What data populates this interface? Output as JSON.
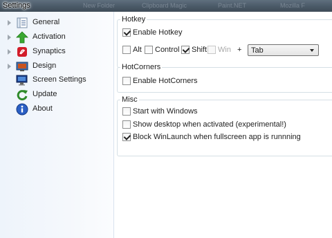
{
  "window": {
    "title": "Settings",
    "background_tabs": [
      "New Folder",
      "Clipboard Magic",
      "Paint.NET",
      "Mozilla F"
    ]
  },
  "sidebar": {
    "items": [
      {
        "label": "General",
        "icon": "general-icon"
      },
      {
        "label": "Activation",
        "icon": "green-arrow-up-icon"
      },
      {
        "label": "Synaptics",
        "icon": "synaptics-icon"
      },
      {
        "label": "Design",
        "icon": "design-icon"
      },
      {
        "label": "Screen Settings",
        "icon": "screen-icon"
      },
      {
        "label": "Update",
        "icon": "update-icon"
      },
      {
        "label": "About",
        "icon": "info-icon"
      }
    ]
  },
  "hotkey": {
    "title": "Hotkey",
    "enable_label": "Enable Hotkey",
    "enable_checked": true,
    "alt_label": "Alt",
    "alt_checked": false,
    "control_label": "Control",
    "control_checked": false,
    "shift_label": "Shift",
    "shift_checked": true,
    "win_label": "Win",
    "win_checked": false,
    "plus": "+",
    "key_value": "Tab"
  },
  "hotcorners": {
    "title": "HotCorners",
    "enable_label": "Enable HotCorners",
    "enable_checked": false
  },
  "misc": {
    "title": "Misc",
    "start_label": "Start with Windows",
    "start_checked": false,
    "show_desktop_label": "Show desktop when activated (experimental!)",
    "show_desktop_checked": false,
    "block_label": "Block WinLaunch when fullscreen app is runnning",
    "block_checked": true
  },
  "colors": {
    "accent_green": "#3aa832",
    "synaptics_red": "#d21d2a",
    "info_blue": "#2a5fc4"
  }
}
